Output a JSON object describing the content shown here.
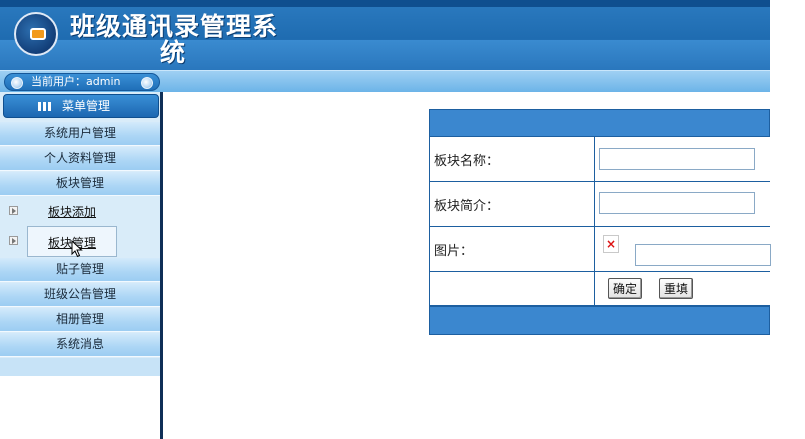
{
  "app": {
    "title": "班级通讯录管理系统",
    "title_line1": "班级通讯录管理系",
    "title_line2": "统"
  },
  "userbar": {
    "text": "当前用户：admin"
  },
  "sidebar": {
    "header": "菜单管理",
    "items": [
      {
        "label": "系统用户管理"
      },
      {
        "label": "个人资料管理"
      },
      {
        "label": "板块管理"
      }
    ],
    "sub_items": [
      {
        "label": "板块添加"
      },
      {
        "label": "板块管理"
      }
    ],
    "items_after": [
      {
        "label": "贴子管理"
      },
      {
        "label": "班级公告管理"
      },
      {
        "label": "相册管理"
      },
      {
        "label": "系统消息"
      }
    ]
  },
  "form": {
    "fields": [
      {
        "label": "板块名称：",
        "value": ""
      },
      {
        "label": "板块简介：",
        "value": ""
      },
      {
        "label": "图片：",
        "value": ""
      }
    ],
    "buttons": {
      "submit": "确定",
      "reset": "重填"
    }
  },
  "colors": {
    "header_blue": "#2c7bc0",
    "nav_light": "#acd6f5",
    "form_border": "#1d5fa0"
  }
}
